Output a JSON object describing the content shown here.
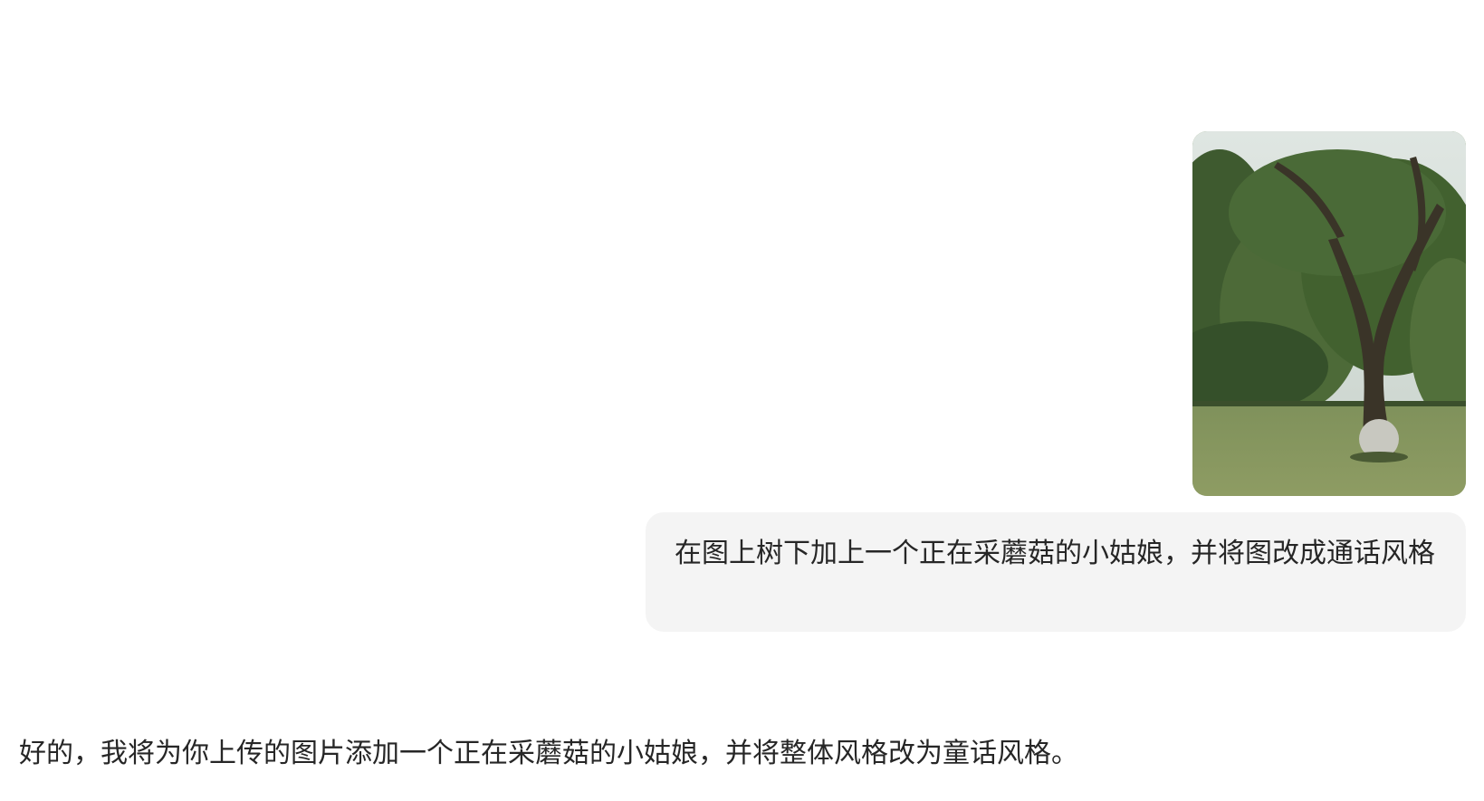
{
  "conversation": {
    "user": {
      "attachment_icon": "photo-tree-in-park",
      "message": "在图上树下加上一个正在采蘑菇的小姑娘，并将图改成通话风格",
      "bubble_color": "#f4f4f4"
    },
    "assistant": {
      "message": "好的，我将为你上传的图片添加一个正在采蘑菇的小姑娘，并将整体风格改为童话风格。"
    }
  }
}
